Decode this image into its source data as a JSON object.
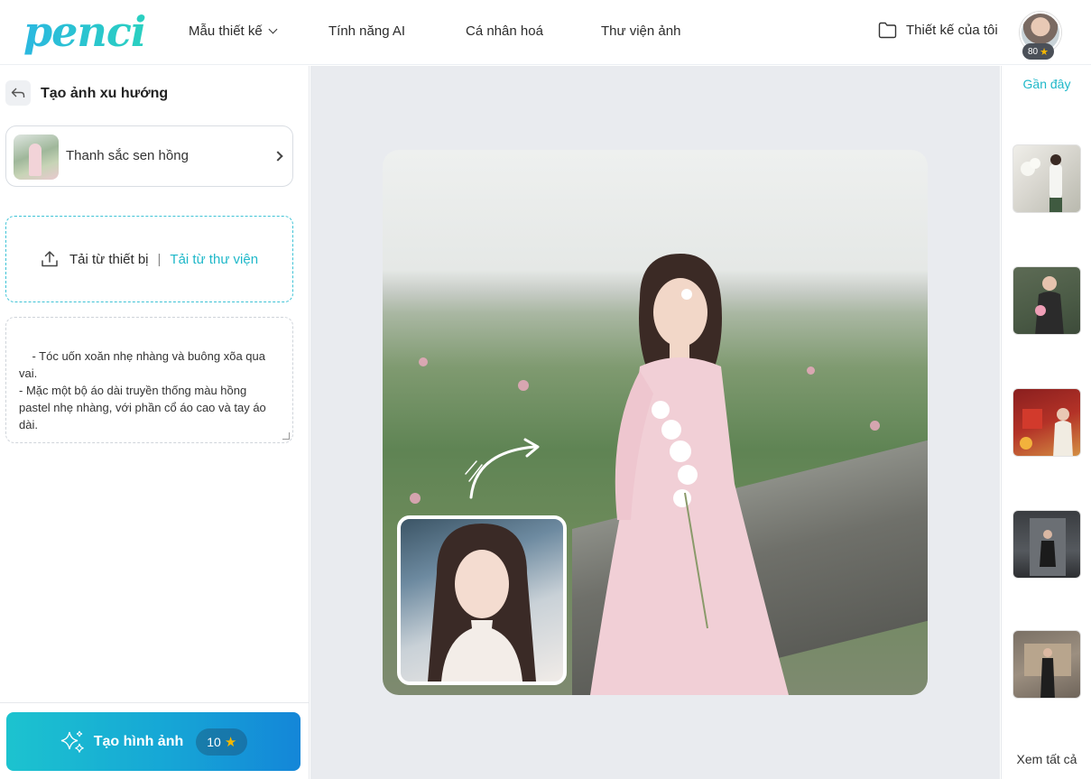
{
  "header": {
    "logo": "penci",
    "nav": [
      {
        "label": "Mẫu thiết kế",
        "has_dropdown": true
      },
      {
        "label": "Tính năng AI"
      },
      {
        "label": "Cá nhân hoá"
      },
      {
        "label": "Thư viện ảnh"
      }
    ],
    "my_designs_label": "Thiết kế của tôi",
    "credits": "80"
  },
  "left_panel": {
    "title": "Tạo ảnh xu hướng",
    "style_card": {
      "name": "Thanh sắc sen hồng"
    },
    "upload": {
      "device_label": "Tải từ thiết bị",
      "separator": "|",
      "library_label": "Tải từ thư viện"
    },
    "prompt_text": "- Tóc uốn xoăn nhẹ nhàng và buông xõa qua vai.\n- Mặc một bộ áo dài truyền thống màu hồng pastel nhẹ nhàng, với phần cổ áo cao và tay áo dài.",
    "generate_button": {
      "label": "Tạo hình ảnh",
      "cost": "10"
    }
  },
  "right_panel": {
    "recent_label": "Gần đây",
    "see_all_label": "Xem tất cả"
  },
  "colors": {
    "accent": "#1fb8c9",
    "button_start": "#1cc3cf",
    "button_end": "#1486d8",
    "star": "#f5b800"
  }
}
